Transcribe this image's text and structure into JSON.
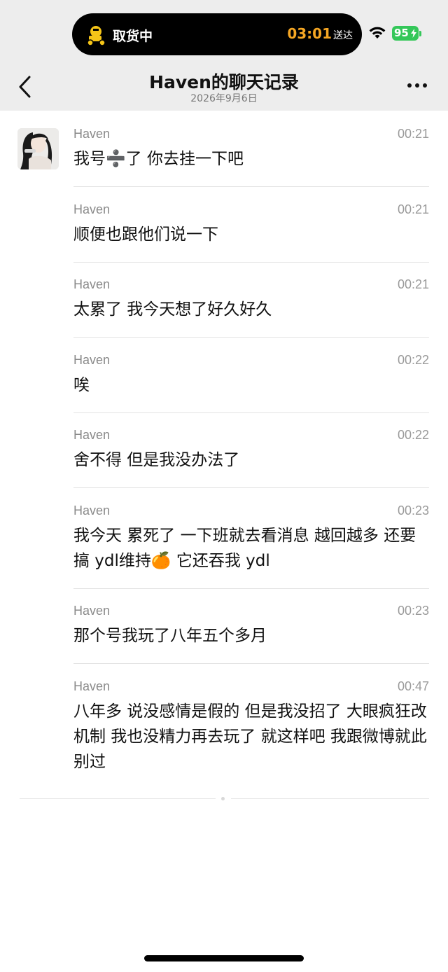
{
  "status_bar": {
    "activity_label": "取货中",
    "eta": "03:01",
    "eta_suffix": "送达",
    "battery": "95"
  },
  "header": {
    "title": "Haven的聊天记录",
    "date": "2026年9月6日"
  },
  "messages": [
    {
      "sender": "Haven",
      "time": "00:21",
      "text": "我号➗了 你去挂一下吧"
    },
    {
      "sender": "Haven",
      "time": "00:21",
      "text": "顺便也跟他们说一下"
    },
    {
      "sender": "Haven",
      "time": "00:21",
      "text": "太累了 我今天想了好久好久"
    },
    {
      "sender": "Haven",
      "time": "00:22",
      "text": "唉"
    },
    {
      "sender": "Haven",
      "time": "00:22",
      "text": "舍不得 但是我没办法了"
    },
    {
      "sender": "Haven",
      "time": "00:23",
      "text": "我今天 累死了 一下班就去看消息 越回越多 还要搞 ydl维持🍊 它还吞我 ydl"
    },
    {
      "sender": "Haven",
      "time": "00:23",
      "text": "那个号我玩了八年五个多月"
    },
    {
      "sender": "Haven",
      "time": "00:47",
      "text": "八年多 说没感情是假的 但是我没招了 大眼疯狂改机制 我也没精力再去玩了 就这样吧 我跟微博就此别过"
    }
  ],
  "colors": {
    "header_bg": "#ededed",
    "eta_color": "#f5a623",
    "battery_color": "#34c759"
  }
}
